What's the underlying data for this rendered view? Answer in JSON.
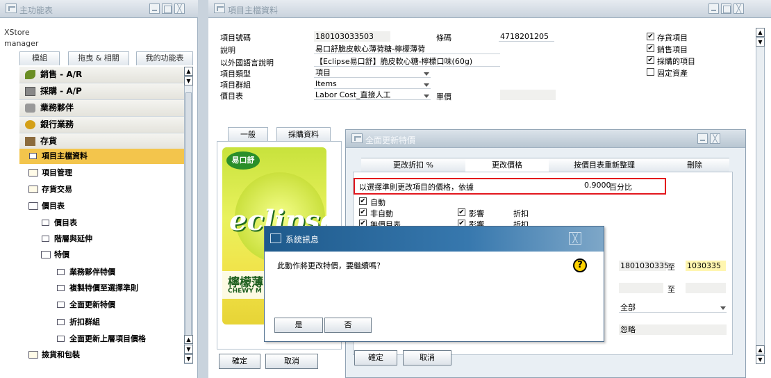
{
  "menu": {
    "title": "主功能表",
    "user": [
      "XStore",
      "manager"
    ],
    "tabs": [
      "模組",
      "拖曳 & 相關",
      "我的功能表"
    ],
    "modules": [
      "銷售 - A/R",
      "採購 - A/P",
      "業務夥伴",
      "銀行業務",
      "存貨"
    ],
    "inventory_sub": [
      "項目主檔資料",
      "項目管理",
      "存貨交易",
      "價目表"
    ],
    "pricelist_sub": [
      "價目表",
      "階層與延伸",
      "特價"
    ],
    "special_sub": [
      "業務夥伴特價",
      "複製特價至選擇準則",
      "全面更新特價",
      "折扣群組",
      "全面更新上層項目價格"
    ],
    "bottom": "撿貨和包裝"
  },
  "item_master": {
    "title": "項目主檔資料",
    "labels": {
      "item_no": "項目號碼",
      "barcode": "條碼",
      "desc": "說明",
      "foreign_desc": "以外國語言說明",
      "item_type": "項目類型",
      "item_group": "項目群組",
      "price_list": "價目表",
      "unit_price": "單價"
    },
    "values": {
      "item_no": "180103033503",
      "barcode": "4718201205",
      "desc": "易口舒脆皮軟心薄荷糖-檸檬薄荷",
      "foreign_desc": "【Eclipse易口舒】脆皮軟心糖-檸檬口味(60g)",
      "item_type": "項目",
      "item_group": "Items",
      "price_list": "Labor Cost_直接人工",
      "unit_price": ""
    },
    "checkboxes": [
      {
        "label": "存貨項目",
        "checked": true
      },
      {
        "label": "銷售項目",
        "checked": true
      },
      {
        "label": "採購的項目",
        "checked": true
      },
      {
        "label": "固定資產",
        "checked": false
      }
    ],
    "tabs": [
      "一般",
      "採購資料"
    ],
    "product_image_text": {
      "brand": "eclipse",
      "top": "易口舒",
      "flavor": "檸檬薄",
      "sub": "CHEWY M"
    },
    "ok": "確定",
    "cancel": "取消"
  },
  "update_dialog": {
    "title": "全面更新特價",
    "tabs": [
      "更改折扣 %",
      "更改價格",
      "按價目表重新整理",
      "刪除"
    ],
    "instruction": "以選擇準則更改項目的價格，依據",
    "value": "0.9000",
    "unit": "百分比",
    "rows": [
      {
        "label": "自動",
        "checked": true
      },
      {
        "label": "非自動",
        "checked": true,
        "influence": "影響",
        "discount": "折扣"
      },
      {
        "label": "無價目表",
        "checked": true,
        "influence": "影響",
        "discount": "折扣"
      }
    ],
    "range_from": "1801030335",
    "range_to_label": "至",
    "range_to": "1030335",
    "to2": "至",
    "dropdown": "全部",
    "ignore": "忽略",
    "ok": "確定",
    "cancel": "取消"
  },
  "system_message": {
    "title": "系統訊息",
    "text": "此動作將更改特價，要繼續嗎？",
    "yes": "是",
    "no": "否"
  }
}
